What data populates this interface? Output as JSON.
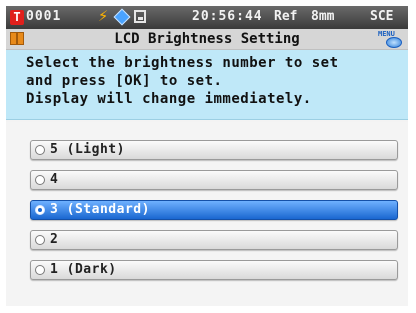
{
  "status": {
    "record": "T",
    "number": "0001",
    "time": "20:56:44",
    "ref": "Ref",
    "mode": "8mm",
    "sce": "SCE"
  },
  "header": {
    "title": "LCD Brightness Setting",
    "menu_label": "MENU"
  },
  "instructions": {
    "line1": "Select the brightness number to set",
    "line2": "and press [OK] to set.",
    "line3": "Display will change immediately."
  },
  "options": [
    {
      "label": "5 (Light)"
    },
    {
      "label": "4"
    },
    {
      "label": "3 (Standard)",
      "selected": true
    },
    {
      "label": "2"
    },
    {
      "label": "1 (Dark)"
    }
  ],
  "colors": {
    "instruction_bg": "#bfe8f8",
    "selected_bg": "#1a67d0"
  }
}
